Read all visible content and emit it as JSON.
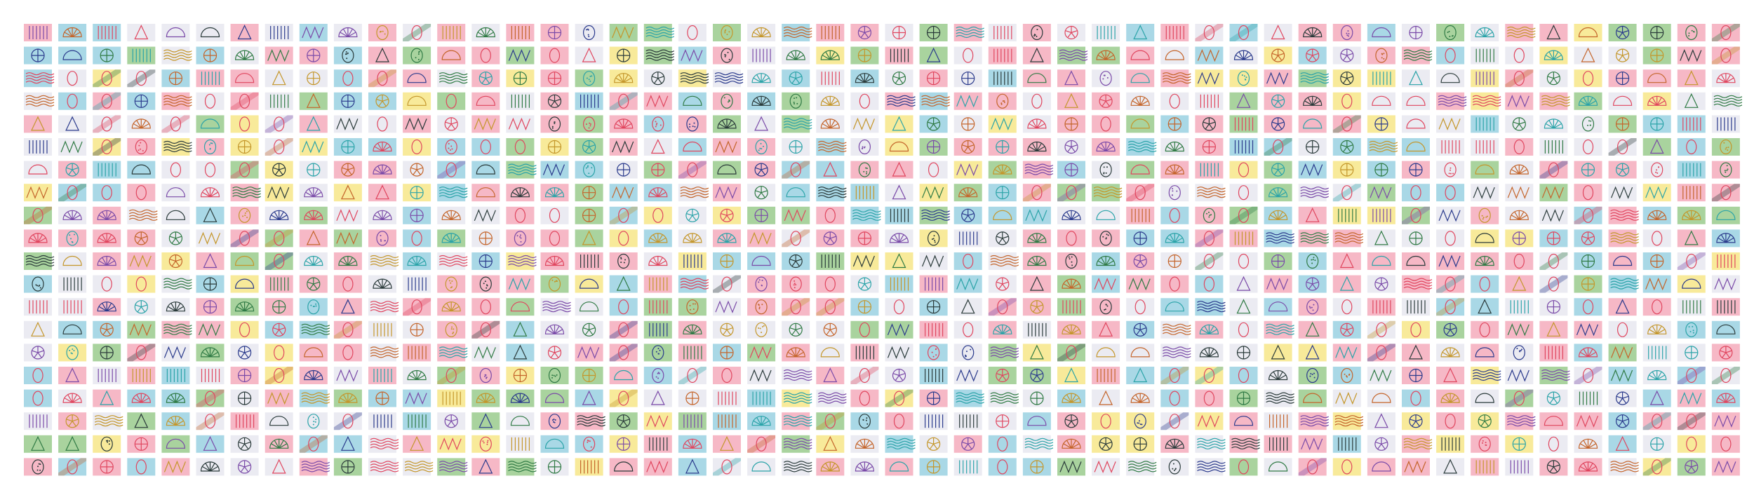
{
  "mosaic": {
    "columns": 50,
    "rows": 20,
    "palette": {
      "pink": "#f6b8c6",
      "yellow": "#f8ea9a",
      "green": "#a9d39e",
      "blue": "#a9d8e6",
      "gray": "#ebebf2",
      "stroke_red": "#e0455e",
      "stroke_navy": "#2a3a8c",
      "stroke_dark": "#2a3a3a",
      "stroke_gold": "#c4962a",
      "stroke_green": "#2f7a44",
      "stroke_teal": "#2aa3a8",
      "stroke_orange": "#c4642a",
      "stroke_purple": "#7a4aa8"
    },
    "shape_kinds": [
      "zero-oval",
      "semicircle",
      "triangle",
      "dotted-oval",
      "semicircle-fan",
      "circle-cross",
      "diagonal-band",
      "vertical-stripes",
      "zigzag",
      "star",
      "horizontal-waves"
    ]
  }
}
